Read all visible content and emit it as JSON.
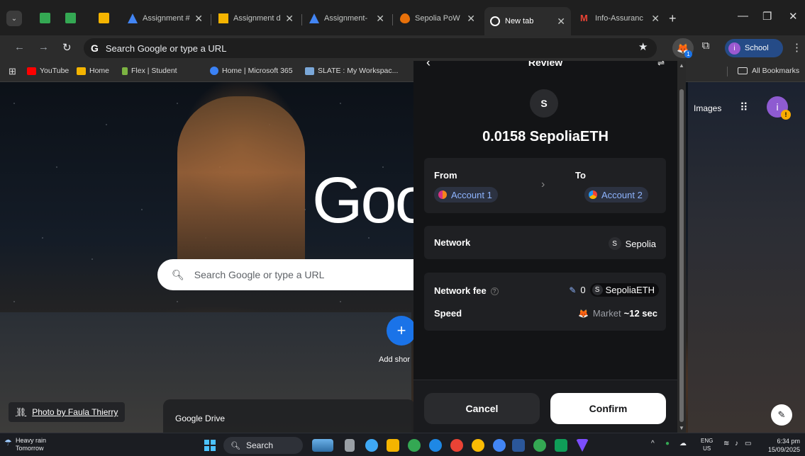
{
  "tabs": [
    {
      "label": "Assignment #",
      "favicon_color": "#f4b400"
    },
    {
      "label": "Assignment d",
      "favicon_color": "#f4b400"
    },
    {
      "label": "Assignment-",
      "favicon_color": "#4285f4"
    },
    {
      "label": "Sepolia PoW",
      "favicon_color": "#e8710a"
    },
    {
      "label": "New tab",
      "favicon_color": "#ffffff",
      "active": true
    },
    {
      "label": "Info-Assuranc",
      "favicon_color": "#ea4335"
    }
  ],
  "toolbar": {
    "omnibox_placeholder": "Search Google or type a URL",
    "omnibox_g": "G",
    "profile_label": "School",
    "profile_initial": "i",
    "ext_badge": "1"
  },
  "bookmarks": {
    "items": [
      "YouTube",
      "Home",
      "Flex | Student",
      "Home | Microsoft 365",
      "SLATE : My Workspac..."
    ],
    "all_label": "All Bookmarks"
  },
  "newtab": {
    "logo_text": "Goo",
    "search_placeholder": "Search Google or type a URL",
    "add_shortcut_label": "Add shor",
    "photo_credit": "Photo by Faula Thierry",
    "drive_label": "Google Drive",
    "images_link": "Images",
    "avatar_initial": "i",
    "avatar_warning": "!"
  },
  "popup": {
    "header_title": "Review",
    "token_symbol": "S",
    "amount": "0.0158 SepoliaETH",
    "from_label": "From",
    "from_account": "Account 1",
    "to_label": "To",
    "to_account": "Account 2",
    "network_label": "Network",
    "network_chip": "S",
    "network_value": "Sepolia",
    "fee_label": "Network fee",
    "fee_amount": "0",
    "fee_chip": "S",
    "fee_currency": "SepoliaETH",
    "speed_label": "Speed",
    "speed_market": "Market",
    "speed_time": "~12 sec",
    "cancel_label": "Cancel",
    "confirm_label": "Confirm"
  },
  "taskbar": {
    "weather_line1": "Heavy rain",
    "weather_line2": "Tomorrow",
    "search_label": "Search",
    "lang_line1": "ENG",
    "lang_line2": "US",
    "time": "6:34 pm",
    "date": "15/09/2025"
  },
  "colors": {
    "accent_blue": "#1a73e8",
    "metamask_link": "#8fb5ff",
    "profile_chip": "#254b87"
  }
}
